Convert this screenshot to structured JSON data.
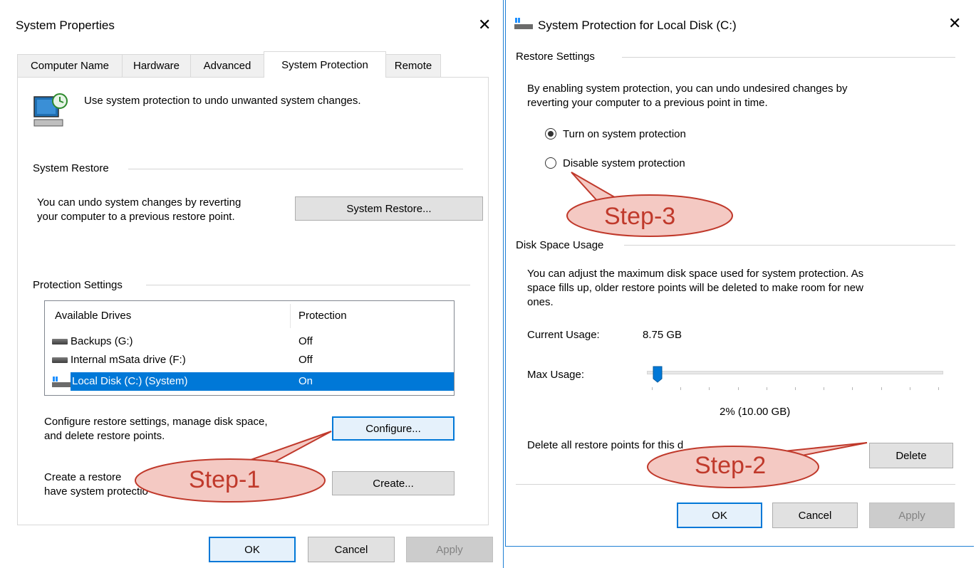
{
  "left_window": {
    "title": "System Properties",
    "tabs": [
      "Computer Name",
      "Hardware",
      "Advanced",
      "System Protection",
      "Remote"
    ],
    "active_tab": "System Protection",
    "intro_text": "Use system protection to undo unwanted system changes.",
    "system_restore": {
      "group_label": "System Restore",
      "text_line1": "You can undo system changes by reverting",
      "text_line2": "your computer to a previous restore point.",
      "button": "System Restore..."
    },
    "protection_settings": {
      "group_label": "Protection Settings",
      "col_drives": "Available Drives",
      "col_protection": "Protection",
      "drives": [
        {
          "name": "Backups (G:)",
          "protection": "Off"
        },
        {
          "name": "Internal mSata drive (F:)",
          "protection": "Off"
        },
        {
          "name": "Local Disk (C:) (System)",
          "protection": "On"
        }
      ],
      "configure_line1": "Configure restore settings, manage disk space,",
      "configure_line2": "and delete restore points.",
      "configure_button": "Configure...",
      "create_line1": "Create a restore",
      "create_line2": "have system protectio",
      "create_button": "Create..."
    },
    "buttons": {
      "ok": "OK",
      "cancel": "Cancel",
      "apply": "Apply"
    }
  },
  "right_window": {
    "title": "System Protection for Local Disk (C:)",
    "restore_settings": {
      "group_label": "Restore Settings",
      "text_line1": "By enabling system protection, you can undo undesired changes by",
      "text_line2": "reverting your computer to a previous point in time.",
      "options": [
        {
          "label": "Turn on system protection",
          "checked": true
        },
        {
          "label": "Disable system protection",
          "checked": false
        }
      ]
    },
    "disk_space": {
      "group_label": "Disk Space Usage",
      "text_line1": "You can adjust the maximum disk space used for system protection. As",
      "text_line2": "space fills up, older restore points will be deleted to make room for new",
      "text_line3": "ones.",
      "current_usage_label": "Current Usage:",
      "current_usage_value": "8.75 GB",
      "max_usage_label": "Max Usage:",
      "max_usage_percent": 2,
      "max_usage_text": "2% (10.00 GB)",
      "delete_text": "Delete all restore points for this d",
      "delete_button": "Delete"
    },
    "buttons": {
      "ok": "OK",
      "cancel": "Cancel",
      "apply": "Apply"
    }
  },
  "callouts": [
    "Step-1",
    "Step-2",
    "Step-3"
  ],
  "colors": {
    "window_border": "#1f7fd4",
    "selection": "#0078d7",
    "callout_fill": "#f4c9c3",
    "callout_stroke": "#c0392b"
  }
}
